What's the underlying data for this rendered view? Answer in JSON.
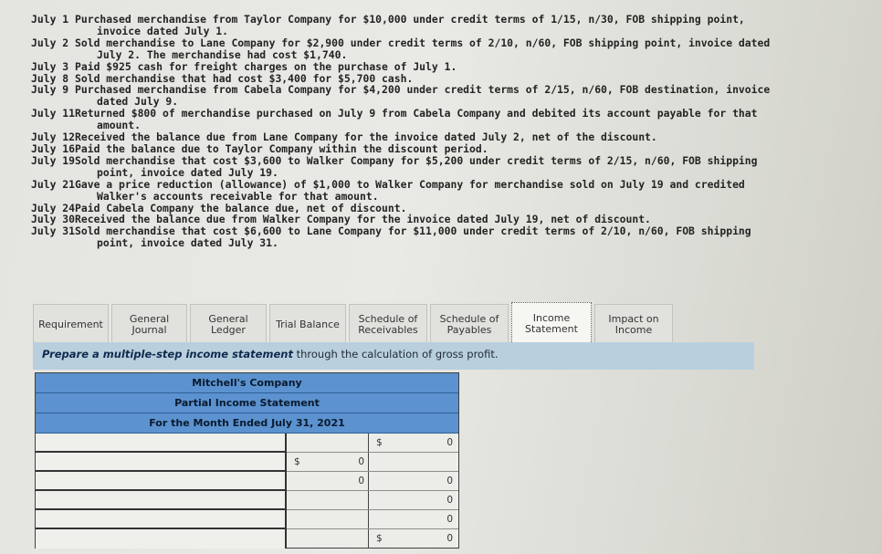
{
  "transactions": [
    {
      "date": "July 1 ",
      "text": "Purchased merchandise from Taylor Company for $10,000 under credit terms of 1/15, n/30, FOB shipping point,",
      "cont": "invoice dated July 1."
    },
    {
      "date": "July 2 ",
      "text": "Sold merchandise to Lane Company for $2,900 under credit terms of 2/10, n/60, FOB shipping point, invoice dated",
      "cont": "July 2. The merchandise had cost $1,740."
    },
    {
      "date": "July 3 ",
      "text": "Paid $925 cash for freight charges on the purchase of July 1.",
      "cont": ""
    },
    {
      "date": "July 8 ",
      "text": "Sold merchandise that had cost $3,400 for $5,700 cash.",
      "cont": ""
    },
    {
      "date": "July 9 ",
      "text": "Purchased merchandise from Cabela Company for $4,200 under credit terms of 2/15, n/60, FOB destination, invoice",
      "cont": "dated July 9."
    },
    {
      "date": "July 11",
      "text": "Returned $800 of merchandise purchased on July 9 from Cabela Company and debited its account payable for that",
      "cont": "amount."
    },
    {
      "date": "July 12",
      "text": "Received the balance due from Lane Company for the invoice dated July 2, net of the discount.",
      "cont": ""
    },
    {
      "date": "July 16",
      "text": "Paid the balance due to Taylor Company within the discount period.",
      "cont": ""
    },
    {
      "date": "July 19",
      "text": "Sold merchandise that cost $3,600 to Walker Company for $5,200 under credit terms of 2/15, n/60, FOB shipping",
      "cont": "point, invoice dated July 19."
    },
    {
      "date": "July 21",
      "text": "Gave a price reduction (allowance) of $1,000 to Walker Company for merchandise sold on July 19 and credited",
      "cont": "Walker's accounts receivable for that amount."
    },
    {
      "date": "July 24",
      "text": "Paid Cabela Company the balance due, net of discount.",
      "cont": ""
    },
    {
      "date": "July 30",
      "text": "Received the balance due from Walker Company for the invoice dated July 19, net of discount.",
      "cont": ""
    },
    {
      "date": "July 31",
      "text": "Sold merchandise that cost $6,600 to Lane Company for $11,000 under credit terms of 2/10, n/60, FOB shipping",
      "cont": "point, invoice dated July 31."
    }
  ],
  "tabs": [
    {
      "l1": "Requirement",
      "l2": ""
    },
    {
      "l1": "General",
      "l2": "Journal"
    },
    {
      "l1": "General",
      "l2": "Ledger"
    },
    {
      "l1": "Trial Balance",
      "l2": ""
    },
    {
      "l1": "Schedule of",
      "l2": "Receivables"
    },
    {
      "l1": "Schedule of",
      "l2": "Payables"
    },
    {
      "l1": "Income",
      "l2": "Statement"
    },
    {
      "l1": "Impact on",
      "l2": "Income"
    }
  ],
  "active_tab": "Income Statement",
  "instruction": {
    "bold": "Prepare a multiple-step income statement",
    "rest": " through the calculation of gross profit."
  },
  "statement": {
    "company": "Mitchell's Company",
    "title": "Partial Income Statement",
    "period": "For the Month Ended July 31, 2021",
    "rows": [
      {
        "label": "",
        "c1_sym": "",
        "c1": "",
        "c2_sym": "$",
        "c2": "0"
      },
      {
        "label": "",
        "c1_sym": "$",
        "c1": "0",
        "c2_sym": "",
        "c2": ""
      },
      {
        "label": "",
        "c1_sym": "",
        "c1": "0",
        "c2_sym": "",
        "c2": "0"
      },
      {
        "label": "",
        "c1_sym": "",
        "c1": "",
        "c2_sym": "",
        "c2": "0"
      },
      {
        "label": "",
        "c1_sym": "",
        "c1": "",
        "c2_sym": "",
        "c2": "0"
      },
      {
        "label": "",
        "c1_sym": "",
        "c1": "",
        "c2_sym": "$",
        "c2": "0"
      }
    ]
  },
  "colors": {
    "header_blue": "#5b92cf",
    "instruction_bar": "#b9cfde"
  }
}
